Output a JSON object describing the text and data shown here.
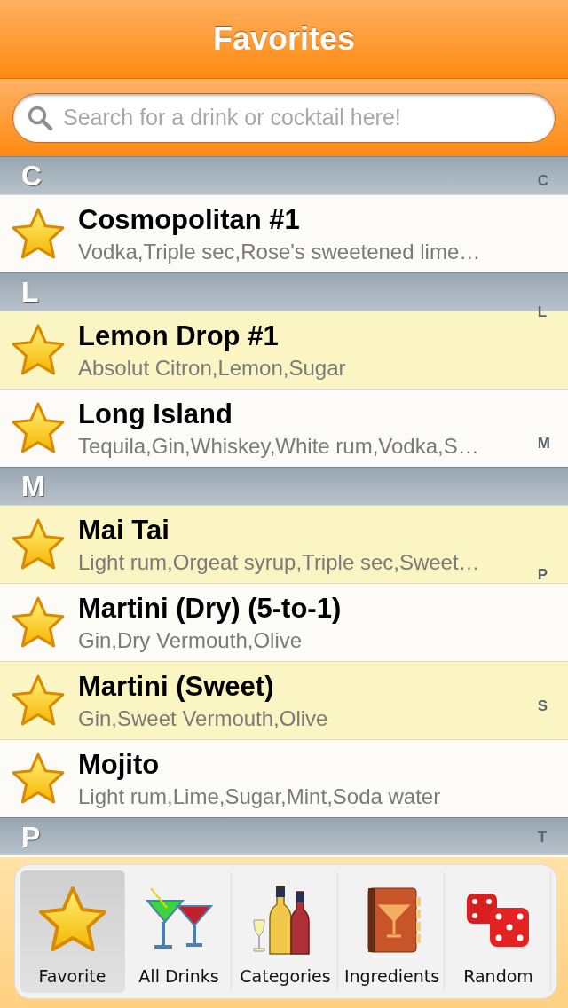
{
  "nav_bar": {
    "title": "Favorites"
  },
  "search": {
    "placeholder": "Search for a drink or cocktail here!"
  },
  "sections": [
    {
      "letter": "C",
      "drinks": [
        {
          "name": "Cosmopolitan #1",
          "ingredients": "Vodka,Triple sec,Rose's sweetened lime…"
        }
      ]
    },
    {
      "letter": "L",
      "drinks": [
        {
          "name": "Lemon Drop #1",
          "ingredients": "Absolut Citron,Lemon,Sugar"
        },
        {
          "name": "Long Island",
          "ingredients": "Tequila,Gin,Whiskey,White rum,Vodka,S…"
        }
      ]
    },
    {
      "letter": "M",
      "drinks": [
        {
          "name": "Mai Tai",
          "ingredients": "Light rum,Orgeat syrup,Triple sec,Sweet…"
        },
        {
          "name": "Martini (Dry) (5-to-1)",
          "ingredients": "Gin,Dry Vermouth,Olive"
        },
        {
          "name": "Martini (Sweet)",
          "ingredients": "Gin,Sweet Vermouth,Olive"
        },
        {
          "name": "Mojito",
          "ingredients": "Light rum,Lime,Sugar,Mint,Soda water"
        }
      ]
    },
    {
      "letter": "P"
    }
  ],
  "section_index": [
    "C",
    "L",
    "M",
    "P",
    "S",
    "T"
  ],
  "tab_bar": [
    {
      "label": "Favorite",
      "kind": "star",
      "selected": true
    },
    {
      "label": "All Drinks",
      "kind": "cocktails",
      "selected": false
    },
    {
      "label": "Categories",
      "kind": "bottles",
      "selected": false
    },
    {
      "label": "Ingredients",
      "kind": "book",
      "selected": false
    },
    {
      "label": "Random",
      "kind": "dice",
      "selected": false
    }
  ]
}
